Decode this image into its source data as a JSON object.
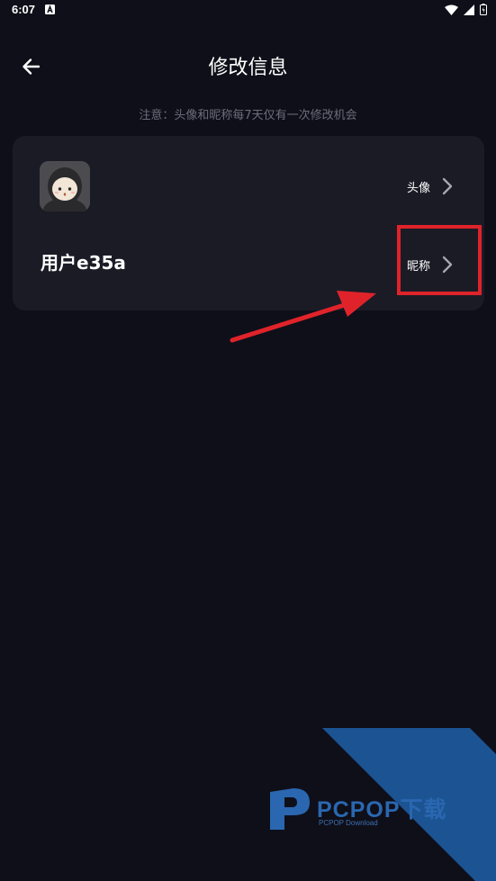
{
  "status_bar": {
    "time": "6:07"
  },
  "header": {
    "title": "修改信息"
  },
  "notice": "注意：头像和昵称每7天仅有一次修改机会",
  "profile": {
    "avatar_label": "头像",
    "username": "用户e35a",
    "nickname_label": "昵称"
  },
  "watermark": {
    "brand": "PCPOP下载",
    "subtitle": "PCPOP Download"
  },
  "colors": {
    "background": "#0f0f19",
    "card": "#1b1b26",
    "notice_text": "#6b6d7a",
    "annotation_red": "#e0232a",
    "watermark_blue": "#1f5fa8"
  },
  "icons": {
    "back": "arrow-left-icon",
    "chevron": "chevron-right-icon"
  }
}
